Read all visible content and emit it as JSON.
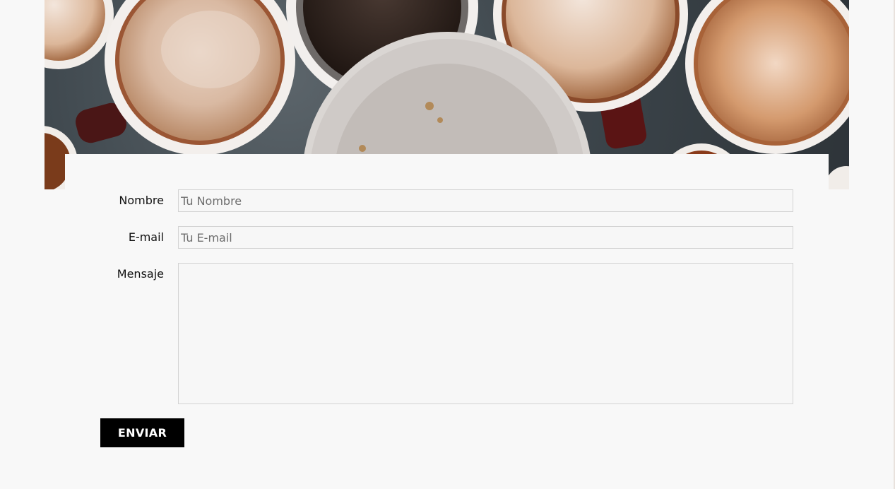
{
  "hero": {
    "image_name": "coffee-cups-photo"
  },
  "form": {
    "name_label": "Nombre",
    "name_placeholder": "Tu Nombre",
    "email_label": "E-mail",
    "email_placeholder": "Tu E-mail",
    "message_label": "Mensaje",
    "message_placeholder": "",
    "submit_label": "ENVIAR"
  },
  "colors": {
    "background": "#f8f8f8",
    "button": "#000000",
    "button_text": "#ffffff",
    "field_border": "#d3d3d3"
  }
}
